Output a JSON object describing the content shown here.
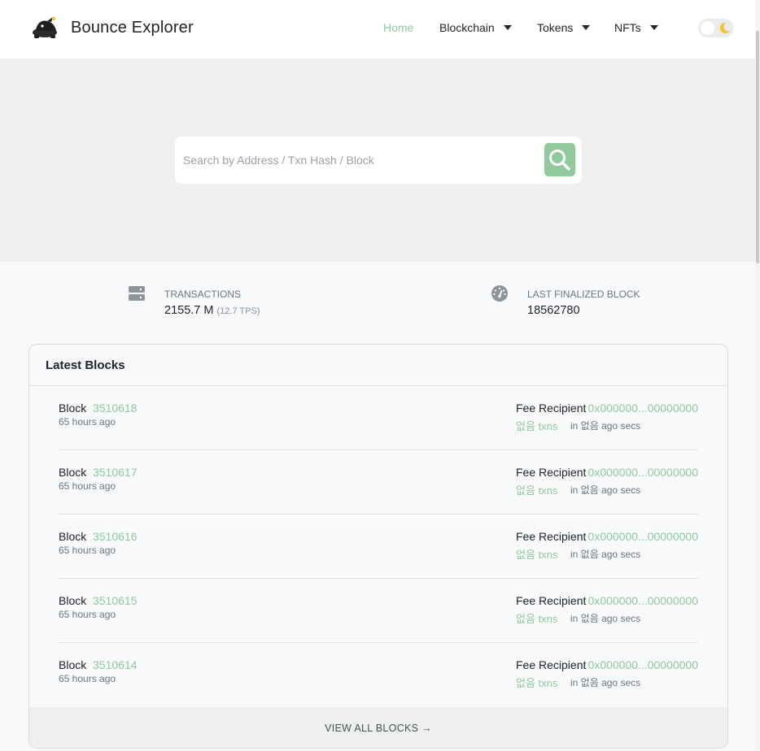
{
  "brand": {
    "name": "Bounce Explorer",
    "logo_icon": "bounce-logo-icon"
  },
  "nav": {
    "items": [
      {
        "label": "Home",
        "active": true,
        "dropdown": false
      },
      {
        "label": "Blockchain",
        "active": false,
        "dropdown": true
      },
      {
        "label": "Tokens",
        "active": false,
        "dropdown": true
      },
      {
        "label": "NFTs",
        "active": false,
        "dropdown": true
      }
    ],
    "theme_toggle_icon": "moon-icon"
  },
  "search": {
    "placeholder": "Search by Address / Txn Hash / Block",
    "value": "",
    "button_icon": "search-icon"
  },
  "stats": {
    "transactions": {
      "label": "TRANSACTIONS",
      "value": "2155.7 M",
      "sub": "(12.7 TPS)",
      "icon": "server-icon"
    },
    "last_block": {
      "label": "LAST FINALIZED BLOCK",
      "value": "18562780",
      "icon": "speedometer-icon"
    }
  },
  "latest_blocks": {
    "title": "Latest Blocks",
    "footer_label": "VIEW ALL BLOCKS →",
    "rows": [
      {
        "block_label": "Block",
        "number": "3510618",
        "age": "65 hours ago",
        "fee_label": "Fee Recipient",
        "fee_address": "0x000000...00000000",
        "txns": "없음 txns",
        "txn_suffix": "in 없음 ago secs"
      },
      {
        "block_label": "Block",
        "number": "3510617",
        "age": "65 hours ago",
        "fee_label": "Fee Recipient",
        "fee_address": "0x000000...00000000",
        "txns": "없음 txns",
        "txn_suffix": "in 없음 ago secs"
      },
      {
        "block_label": "Block",
        "number": "3510616",
        "age": "65 hours ago",
        "fee_label": "Fee Recipient",
        "fee_address": "0x000000...00000000",
        "txns": "없음 txns",
        "txn_suffix": "in 없음 ago secs"
      },
      {
        "block_label": "Block",
        "number": "3510615",
        "age": "65 hours ago",
        "fee_label": "Fee Recipient",
        "fee_address": "0x000000...00000000",
        "txns": "없음 txns",
        "txn_suffix": "in 없음 ago secs"
      },
      {
        "block_label": "Block",
        "number": "3510614",
        "age": "65 hours ago",
        "fee_label": "Fee Recipient",
        "fee_address": "0x000000...00000000",
        "txns": "없음 txns",
        "txn_suffix": "in 없음 ago secs"
      }
    ]
  },
  "colors": {
    "accent": "#8fc99d",
    "hero_bg": "#eef0ef",
    "page_bg": "#f8f9fa",
    "moon": "#f7c42b"
  }
}
